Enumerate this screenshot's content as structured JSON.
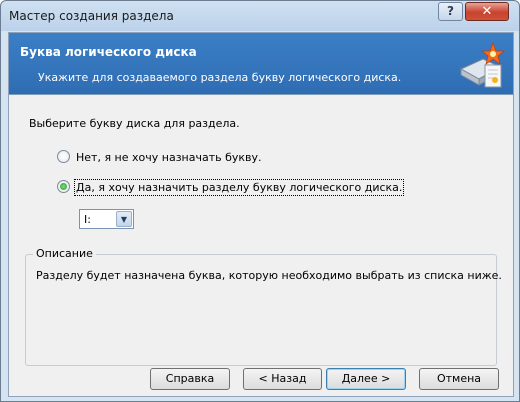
{
  "window": {
    "title": "Мастер создания раздела",
    "help_label": "?",
    "close_label": "✕"
  },
  "header": {
    "title": "Буква логического диска",
    "subtitle": "Укажите для создаваемого раздела букву логического диска."
  },
  "prompt": "Выберите букву диска для раздела.",
  "options": [
    {
      "label": "Нет, я не хочу назначать букву.",
      "checked": false
    },
    {
      "label": "Да, я хочу назначить разделу букву логического диска.",
      "checked": true
    }
  ],
  "drive_select": {
    "value": "I:"
  },
  "description": {
    "title": "Описание",
    "text": "Разделу будет назначена буква, которую необходимо выбрать из списка ниже."
  },
  "buttons": {
    "help": "Справка",
    "back": "< Назад",
    "next": "Далее >",
    "cancel": "Отмена"
  },
  "icons": {
    "header": "disk-wizard-icon"
  }
}
